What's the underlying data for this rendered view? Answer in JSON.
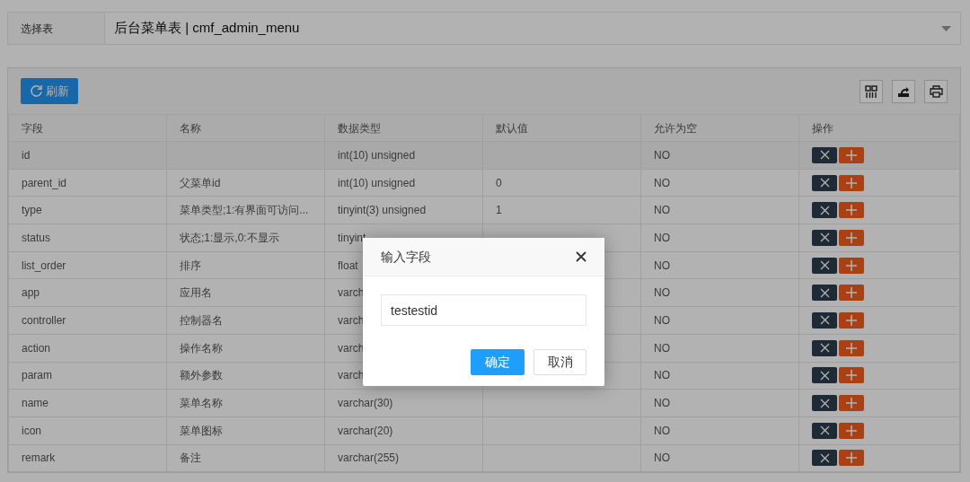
{
  "table_select": {
    "label": "选择表",
    "value": "后台菜单表 | cmf_admin_menu"
  },
  "toolbar": {
    "refresh_button": "刷新"
  },
  "table": {
    "columns": [
      "字段",
      "名称",
      "数据类型",
      "默认值",
      "允许为空",
      "操作"
    ],
    "rows": [
      {
        "cells": [
          "id",
          "",
          "int(10) unsigned",
          "",
          "NO"
        ]
      },
      {
        "cells": [
          "parent_id",
          "父菜单id",
          "int(10) unsigned",
          "0",
          "NO"
        ]
      },
      {
        "cells": [
          "type",
          "菜单类型;1:有界面可访问...",
          "tinyint(3) unsigned",
          "1",
          "NO"
        ]
      },
      {
        "cells": [
          "status",
          "状态;1:显示,0:不显示",
          "tinyint",
          "",
          "NO"
        ]
      },
      {
        "cells": [
          "list_order",
          "排序",
          "float",
          "",
          "NO"
        ]
      },
      {
        "cells": [
          "app",
          "应用名",
          "varch",
          "",
          "NO"
        ]
      },
      {
        "cells": [
          "controller",
          "控制器名",
          "varch",
          "",
          "NO"
        ]
      },
      {
        "cells": [
          "action",
          "操作名称",
          "varch",
          "",
          "NO"
        ]
      },
      {
        "cells": [
          "param",
          "额外参数",
          "varch",
          "",
          "NO"
        ]
      },
      {
        "cells": [
          "name",
          "菜单名称",
          "varchar(30)",
          "",
          "NO"
        ]
      },
      {
        "cells": [
          "icon",
          "菜单图标",
          "varchar(20)",
          "",
          "NO"
        ]
      },
      {
        "cells": [
          "remark",
          "备注",
          "varchar(255)",
          "",
          "NO"
        ]
      }
    ]
  },
  "dialog": {
    "title": "输入字段",
    "input_value": "testestid",
    "buttons": [
      "确定",
      "取消"
    ]
  }
}
